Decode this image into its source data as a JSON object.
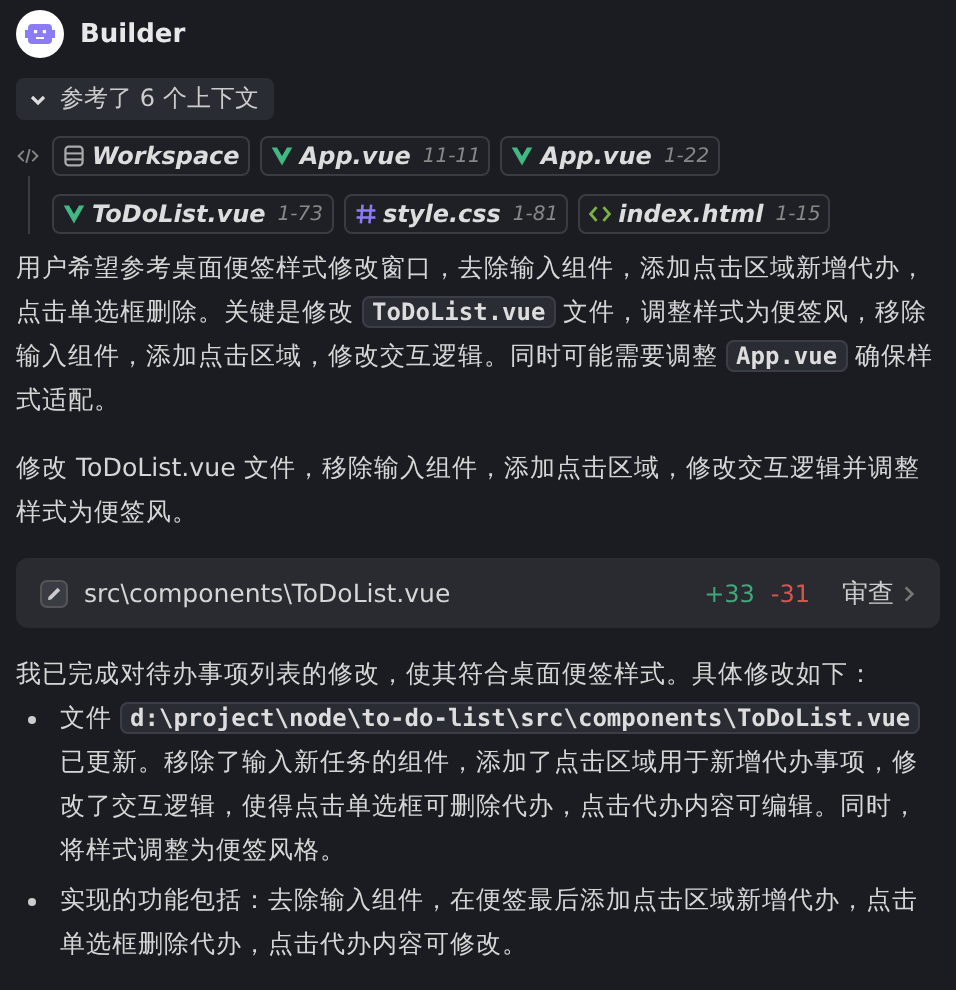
{
  "header": {
    "name": "Builder"
  },
  "context_toggle": {
    "label": "参考了 6 个上下文",
    "expanded": true
  },
  "contexts": [
    {
      "kind": "workspace",
      "name": "Workspace"
    },
    {
      "kind": "vue",
      "name": "App.vue",
      "range": "11-11"
    },
    {
      "kind": "vue",
      "name": "App.vue",
      "range": "1-22"
    },
    {
      "kind": "vue",
      "name": "ToDoList.vue",
      "range": "1-73"
    },
    {
      "kind": "css",
      "name": "style.css",
      "range": "1-81"
    },
    {
      "kind": "html",
      "name": "index.html",
      "range": "1-15"
    }
  ],
  "thought": [
    {
      "kind": "text",
      "text": "用户希望参考桌面便签样式修改窗口，去除输入组件，添加点击区域新增代办，点击单选框删除。关键是修改 "
    },
    {
      "kind": "code",
      "text": "ToDoList.vue"
    },
    {
      "kind": "text",
      "text": " 文件，调整样式为便签风，移除输入组件，添加点击区域，修改交互逻辑。同时可能需要调整 "
    },
    {
      "kind": "code",
      "text": "App.vue"
    },
    {
      "kind": "text",
      "text": " 确保样式适配。"
    }
  ],
  "plan": "修改 ToDoList.vue 文件，移除输入组件，添加点击区域，修改交互逻辑并调整样式为便签风。",
  "file_change": {
    "path": "src\\components\\ToDoList.vue",
    "added": "+33",
    "removed": "-31",
    "action": "审查"
  },
  "summary": "我已完成对待办事项列表的修改，使其符合桌面便签样式。具体修改如下：",
  "bullets": [
    [
      {
        "kind": "text",
        "text": "文件 "
      },
      {
        "kind": "code",
        "text": "d:\\project\\node\\to-do-list\\src\\components\\ToDoList.vue"
      },
      {
        "kind": "text",
        "text": " 已更新。移除了输入新任务的组件，添加了点击区域用于新增代办事项，修改了交互逻辑，使得点击单选框可删除代办，点击代办内容可编辑。同时，将样式调整为便签风格。"
      }
    ],
    [
      {
        "kind": "text",
        "text": "实现的功能包括：去除输入组件，在便签最后添加点击区域新增代办，点击单选框删除代办，点击代办内容可修改。"
      }
    ]
  ]
}
